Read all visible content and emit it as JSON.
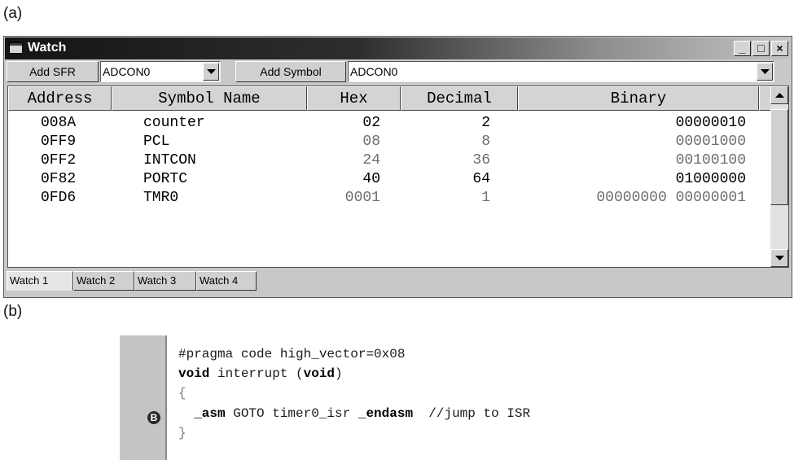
{
  "figure_labels": {
    "a": "(a)",
    "b": "(b)"
  },
  "window": {
    "title": "Watch",
    "controls": {
      "minimize": "_",
      "maximize": "□",
      "close": "×"
    }
  },
  "toolbar": {
    "add_sfr_label": "Add SFR",
    "sfr_combo_value": "ADCON0",
    "add_symbol_label": "Add Symbol",
    "symbol_combo_value": "ADCON0"
  },
  "grid": {
    "columns": [
      "Address",
      "Symbol Name",
      "Hex",
      "Decimal",
      "Binary"
    ],
    "rows": [
      {
        "address": "008A",
        "symbol": "counter",
        "hex": "02",
        "decimal": "2",
        "binary": "00000010",
        "changed": true
      },
      {
        "address": "0FF9",
        "symbol": "PCL",
        "hex": "08",
        "decimal": "8",
        "binary": "00001000",
        "changed": false
      },
      {
        "address": "0FF2",
        "symbol": "INTCON",
        "hex": "24",
        "decimal": "36",
        "binary": "00100100",
        "changed": false
      },
      {
        "address": "0F82",
        "symbol": "PORTC",
        "hex": "40",
        "decimal": "64",
        "binary": "01000000",
        "changed": true
      },
      {
        "address": "0FD6",
        "symbol": "TMR0",
        "hex": "0001",
        "decimal": "1",
        "binary": "00000000 00000001",
        "changed": false
      }
    ]
  },
  "tabs": [
    "Watch 1",
    "Watch 2",
    "Watch 3",
    "Watch 4"
  ],
  "active_tab": "Watch 1",
  "code": {
    "breakpoint_marker": "B",
    "line1": "#pragma code high_vector=0x08",
    "line2_kw1": "void",
    "line2_mid": " interrupt (",
    "line2_kw2": "void",
    "line2_end": ")",
    "line3": "{",
    "line4_kw1": "_asm",
    "line4_mid": " GOTO timer0_isr ",
    "line4_kw2": "_endasm",
    "line4_comment": "  //jump to ISR",
    "line5": "}"
  }
}
